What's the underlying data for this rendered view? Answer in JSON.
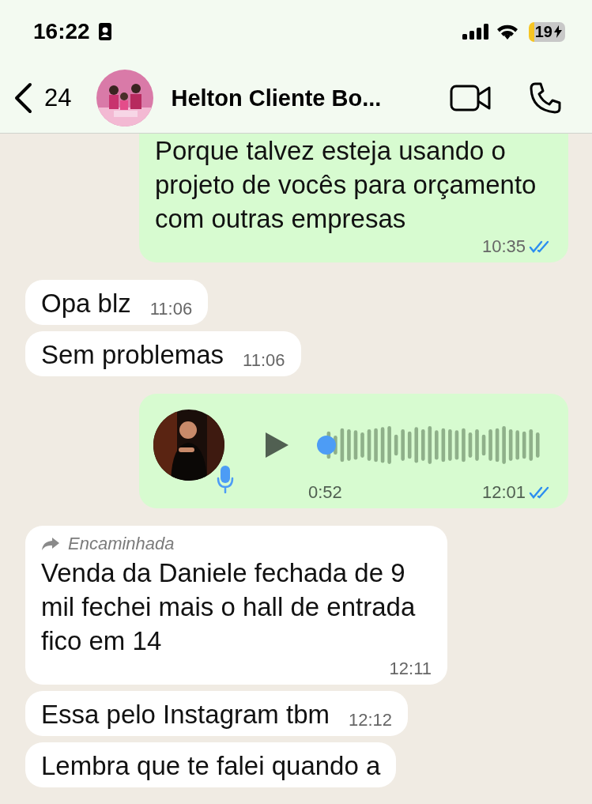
{
  "status_bar": {
    "time": "16:22",
    "battery": "19"
  },
  "header": {
    "back_count": "24",
    "contact_name": "Helton Cliente Bo..."
  },
  "messages": [
    {
      "kind": "text",
      "outgoing": true,
      "text": "Porque talvez esteja usando o projeto de vocês para orçamento com outras empresas",
      "time": "10:35",
      "read": true
    },
    {
      "kind": "text",
      "outgoing": false,
      "text": "Opa blz",
      "time": "11:06"
    },
    {
      "kind": "text",
      "outgoing": false,
      "text": "Sem problemas",
      "time": "11:06"
    },
    {
      "kind": "voice",
      "outgoing": true,
      "duration": "0:52",
      "time": "12:01",
      "read": true
    },
    {
      "kind": "text",
      "outgoing": false,
      "forwarded_label": "Encaminhada",
      "text": "Venda da Daniele fechada de 9 mil fechei mais o hall de entrada fico em 14",
      "time": "12:11"
    },
    {
      "kind": "text",
      "outgoing": false,
      "text": "Essa pelo Instagram tbm",
      "time": "12:12"
    },
    {
      "kind": "text",
      "outgoing": false,
      "text": "Lembra que te falei quando a"
    }
  ]
}
